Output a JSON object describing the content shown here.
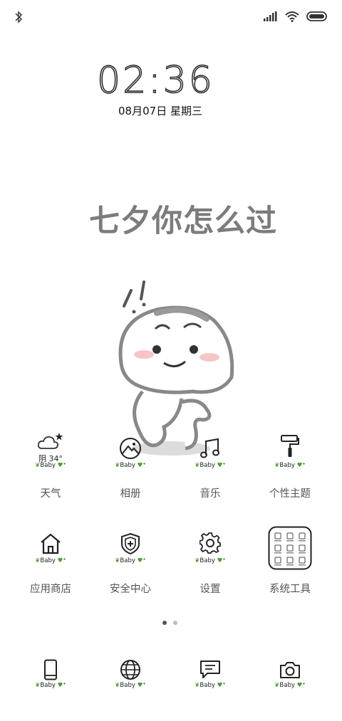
{
  "status_bar": {
    "bluetooth_icon": "bluetooth-icon",
    "signal_icon": "signal-icon",
    "wifi_icon": "wifi-icon",
    "battery_icon": "battery-icon"
  },
  "clock": {
    "time": "02:36",
    "date": "08月07日 星期三"
  },
  "headline": "七夕你怎么过",
  "tag_text": "Baby",
  "apps_row1": [
    {
      "label": "天气",
      "icon": "weather-cloud-star-icon",
      "sub": "阴 34°"
    },
    {
      "label": "相册",
      "icon": "gallery-landscape-icon"
    },
    {
      "label": "音乐",
      "icon": "music-note-icon"
    },
    {
      "label": "个性主题",
      "icon": "paint-roller-icon"
    }
  ],
  "apps_row2": [
    {
      "label": "应用商店",
      "icon": "house-store-icon"
    },
    {
      "label": "安全中心",
      "icon": "shield-icon"
    },
    {
      "label": "设置",
      "icon": "gear-icon"
    },
    {
      "label": "系统工具",
      "icon": "folder-grid-icon"
    }
  ],
  "dock": [
    {
      "icon": "phone-icon"
    },
    {
      "icon": "browser-globe-icon"
    },
    {
      "icon": "message-icon"
    },
    {
      "icon": "camera-icon"
    }
  ],
  "page_indicator": {
    "pages": 2,
    "current": 1,
    "active_color": "#555555",
    "inactive_color": "#bbbbbb"
  }
}
